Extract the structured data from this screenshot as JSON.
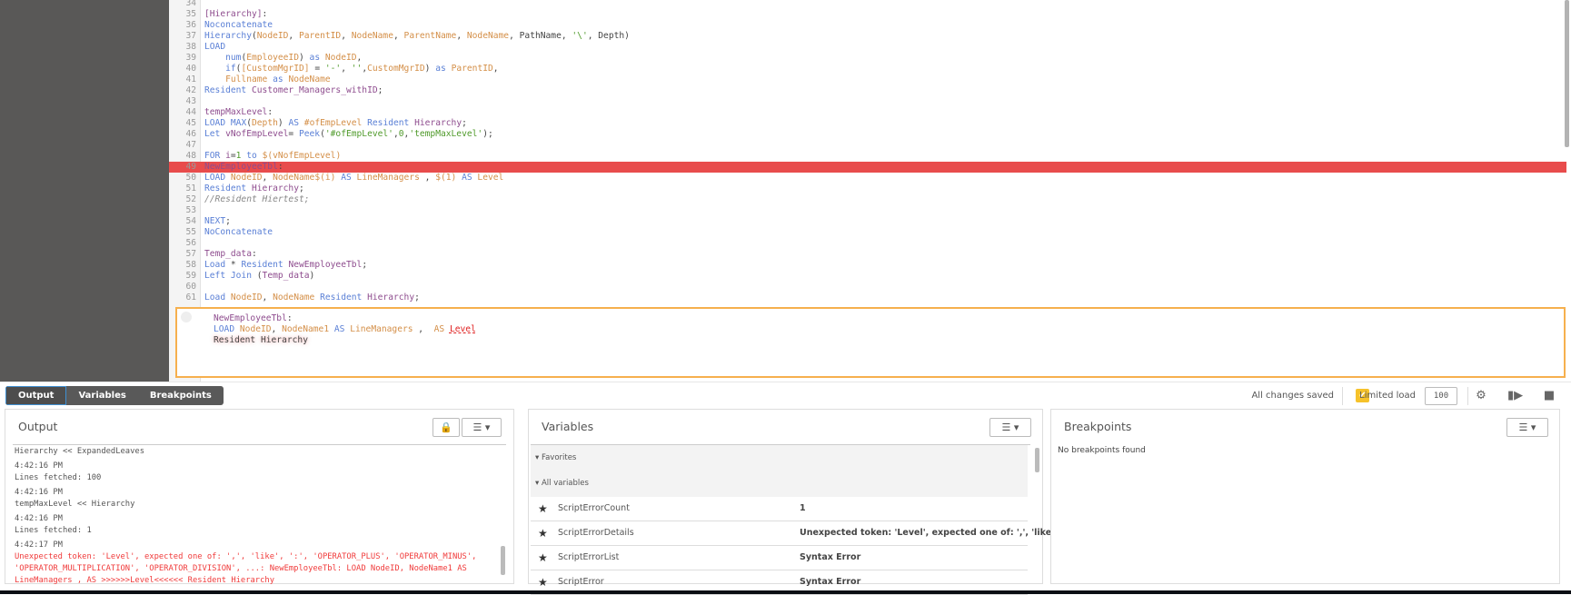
{
  "editor": {
    "lines": [
      {
        "n": "34",
        "t": []
      },
      {
        "n": "35",
        "t": [
          [
            "tbl",
            "[Hierarchy]"
          ],
          [
            "pl",
            ":"
          ]
        ]
      },
      {
        "n": "36",
        "t": [
          [
            "kw",
            "Noconcatenate"
          ]
        ]
      },
      {
        "n": "37",
        "t": [
          [
            "kw",
            "Hierarchy"
          ],
          [
            "pl",
            "("
          ],
          [
            "fld",
            "NodeID"
          ],
          [
            "pl",
            ", "
          ],
          [
            "fld",
            "ParentID"
          ],
          [
            "pl",
            ", "
          ],
          [
            "fld",
            "NodeName"
          ],
          [
            "pl",
            ", "
          ],
          [
            "fld",
            "ParentName"
          ],
          [
            "pl",
            ", "
          ],
          [
            "fld",
            "NodeName"
          ],
          [
            "pl",
            ", PathName, "
          ],
          [
            "str",
            "'\\'"
          ],
          [
            "pl",
            ", Depth)"
          ]
        ]
      },
      {
        "n": "38",
        "t": [
          [
            "kw",
            "LOAD"
          ]
        ]
      },
      {
        "n": "39",
        "t": [
          [
            "pl",
            "    "
          ],
          [
            "kw",
            "num"
          ],
          [
            "pl",
            "("
          ],
          [
            "fld",
            "EmployeeID"
          ],
          [
            "pl",
            ") "
          ],
          [
            "kw",
            "as"
          ],
          [
            "pl",
            " "
          ],
          [
            "fld",
            "NodeID"
          ],
          [
            "pl",
            ","
          ]
        ]
      },
      {
        "n": "40",
        "t": [
          [
            "pl",
            "    "
          ],
          [
            "kw",
            "if"
          ],
          [
            "pl",
            "("
          ],
          [
            "fld",
            "[CustomMgrID]"
          ],
          [
            "pl",
            " = "
          ],
          [
            "str",
            "'-'"
          ],
          [
            "pl",
            ", "
          ],
          [
            "str",
            "''"
          ],
          [
            "pl",
            ","
          ],
          [
            "fld",
            "CustomMgrID"
          ],
          [
            "pl",
            ") "
          ],
          [
            "kw",
            "as"
          ],
          [
            "pl",
            " "
          ],
          [
            "fld",
            "ParentID"
          ],
          [
            "pl",
            ","
          ]
        ]
      },
      {
        "n": "41",
        "t": [
          [
            "pl",
            "    "
          ],
          [
            "fld",
            "Fullname"
          ],
          [
            "pl",
            " "
          ],
          [
            "kw",
            "as"
          ],
          [
            "pl",
            " "
          ],
          [
            "fld",
            "NodeName"
          ]
        ]
      },
      {
        "n": "42",
        "t": [
          [
            "kw",
            "Resident"
          ],
          [
            "pl",
            " "
          ],
          [
            "tbl",
            "Customer_Managers_withID"
          ],
          [
            "pl",
            ";"
          ]
        ]
      },
      {
        "n": "43",
        "t": []
      },
      {
        "n": "44",
        "t": [
          [
            "tbl",
            "tempMaxLevel"
          ],
          [
            "pl",
            ":"
          ]
        ]
      },
      {
        "n": "45",
        "t": [
          [
            "kw",
            "LOAD"
          ],
          [
            "pl",
            " "
          ],
          [
            "kw",
            "MAX"
          ],
          [
            "pl",
            "("
          ],
          [
            "fld",
            "Depth"
          ],
          [
            "pl",
            ") "
          ],
          [
            "kw",
            "AS"
          ],
          [
            "pl",
            " "
          ],
          [
            "fld",
            "#ofEmpLevel"
          ],
          [
            "pl",
            " "
          ],
          [
            "kw",
            "Resident"
          ],
          [
            "pl",
            " "
          ],
          [
            "tbl",
            "Hierarchy"
          ],
          [
            "pl",
            ";"
          ]
        ]
      },
      {
        "n": "46",
        "t": [
          [
            "kw",
            "Let"
          ],
          [
            "pl",
            " "
          ],
          [
            "tbl",
            "vNofEmpLevel"
          ],
          [
            "pl",
            "= "
          ],
          [
            "kw",
            "Peek"
          ],
          [
            "pl",
            "("
          ],
          [
            "str",
            "'#ofEmpLevel'"
          ],
          [
            "pl",
            ","
          ],
          [
            "num",
            "0"
          ],
          [
            "pl",
            ","
          ],
          [
            "str",
            "'tempMaxLevel'"
          ],
          [
            "pl",
            ");"
          ]
        ]
      },
      {
        "n": "47",
        "t": []
      },
      {
        "n": "48",
        "t": [
          [
            "kw",
            "FOR"
          ],
          [
            "pl",
            " "
          ],
          [
            "tbl",
            "i"
          ],
          [
            "pl",
            "="
          ],
          [
            "num",
            "1"
          ],
          [
            "pl",
            " "
          ],
          [
            "kw",
            "to"
          ],
          [
            "pl",
            " "
          ],
          [
            "fld",
            "$(vNofEmpLevel)"
          ]
        ]
      },
      {
        "n": "49",
        "t": [
          [
            "tbl",
            "NewEmployeeTbl"
          ],
          [
            "pl",
            ":"
          ]
        ],
        "highlight": true
      },
      {
        "n": "50",
        "t": [
          [
            "kw",
            "LOAD"
          ],
          [
            "pl",
            " "
          ],
          [
            "fld",
            "NodeID"
          ],
          [
            "pl",
            ", "
          ],
          [
            "fld",
            "NodeName$(i)"
          ],
          [
            "pl",
            " "
          ],
          [
            "kw",
            "AS"
          ],
          [
            "pl",
            " "
          ],
          [
            "fld",
            "LineManagers"
          ],
          [
            "pl",
            " , "
          ],
          [
            "fld",
            "$(1)"
          ],
          [
            "pl",
            " "
          ],
          [
            "kw",
            "AS"
          ],
          [
            "pl",
            " "
          ],
          [
            "fld",
            "Level"
          ]
        ]
      },
      {
        "n": "51",
        "t": [
          [
            "kw",
            "Resident"
          ],
          [
            "pl",
            " "
          ],
          [
            "tbl",
            "Hierarchy"
          ],
          [
            "pl",
            ";"
          ]
        ]
      },
      {
        "n": "52",
        "t": [
          [
            "cmt",
            "//Resident Hiertest;"
          ]
        ]
      },
      {
        "n": "53",
        "t": []
      },
      {
        "n": "54",
        "t": [
          [
            "kw",
            "NEXT"
          ],
          [
            "pl",
            ";"
          ]
        ]
      },
      {
        "n": "55",
        "t": [
          [
            "kw",
            "NoConcatenate"
          ]
        ]
      },
      {
        "n": "56",
        "t": []
      },
      {
        "n": "57",
        "t": [
          [
            "tbl",
            "Temp_data"
          ],
          [
            "pl",
            ":"
          ]
        ]
      },
      {
        "n": "58",
        "t": [
          [
            "kw",
            "Load"
          ],
          [
            "pl",
            " * "
          ],
          [
            "kw",
            "Resident"
          ],
          [
            "pl",
            " "
          ],
          [
            "tbl",
            "NewEmployeeTbl"
          ],
          [
            "pl",
            ";"
          ]
        ]
      },
      {
        "n": "59",
        "t": [
          [
            "kw",
            "Left Join"
          ],
          [
            "pl",
            " ("
          ],
          [
            "tbl",
            "Temp_data"
          ],
          [
            "pl",
            ")"
          ]
        ]
      },
      {
        "n": "60",
        "t": []
      },
      {
        "n": "61",
        "t": [
          [
            "kw",
            "Load"
          ],
          [
            "pl",
            " "
          ],
          [
            "fld",
            "NodeID"
          ],
          [
            "pl",
            ", "
          ],
          [
            "fld",
            "NodeName"
          ],
          [
            "pl",
            " "
          ],
          [
            "kw",
            "Resident"
          ],
          [
            "pl",
            " "
          ],
          [
            "tbl",
            "Hierarchy"
          ],
          [
            "pl",
            ";"
          ]
        ]
      }
    ],
    "popup_lines": [
      [
        [
          "tbl",
          "NewEmployeeTbl"
        ],
        [
          "pl",
          ":"
        ]
      ],
      [
        [
          "kw",
          "LOAD"
        ],
        [
          "pl",
          " "
        ],
        [
          "fld",
          "NodeID"
        ],
        [
          "pl",
          ", "
        ],
        [
          "fld",
          "NodeName1"
        ],
        [
          "pl",
          " "
        ],
        [
          "kw",
          "AS"
        ],
        [
          "pl",
          " "
        ],
        [
          "fld",
          "LineManagers"
        ],
        [
          "pl",
          " ,  "
        ],
        [
          "fld",
          "AS"
        ],
        [
          "pl",
          " "
        ],
        [
          "err",
          "Level"
        ]
      ],
      [
        [
          "glow",
          "Resident Hierarchy"
        ]
      ]
    ]
  },
  "tabs": [
    "Output",
    "Variables",
    "Breakpoints"
  ],
  "toolbar": {
    "status": "All changes saved",
    "limited_load_label": "Limited load",
    "limited_load_checked": true,
    "limited_load_value": "100",
    "check_glyph": "✔",
    "accent": "#f6c22a"
  },
  "output": {
    "title": "Output",
    "log": [
      {
        "type": "msg",
        "text": "Hierarchy << ExpandedLeaves"
      },
      {
        "type": "ts",
        "text": "4:42:16 PM"
      },
      {
        "type": "msg",
        "text": "Lines fetched: 100"
      },
      {
        "type": "ts",
        "text": "4:42:16 PM"
      },
      {
        "type": "msg",
        "text": "tempMaxLevel << Hierarchy"
      },
      {
        "type": "ts",
        "text": "4:42:16 PM"
      },
      {
        "type": "msg",
        "text": "Lines fetched: 1"
      },
      {
        "type": "ts",
        "text": "4:42:17 PM"
      },
      {
        "type": "error",
        "text": "Unexpected token: 'Level', expected one of: ',', 'like', ':', 'OPERATOR_PLUS', 'OPERATOR_MINUS', 'OPERATOR_MULTIPLICATION', 'OPERATOR_DIVISION', ...: NewEmployeeTbl: LOAD NodeID, NodeName1 AS LineManagers , AS >>>>>>Level<<<<<< Resident Hierarchy"
      }
    ]
  },
  "variables": {
    "title": "Variables",
    "groups": [
      "Favorites",
      "All variables"
    ],
    "rows": [
      {
        "name": "ScriptErrorCount",
        "value": "1"
      },
      {
        "name": "ScriptErrorDetails",
        "value": "Unexpected token: 'Level', expected one of: ',', 'like', ':', '..."
      },
      {
        "name": "ScriptErrorList",
        "value": "Syntax Error"
      },
      {
        "name": "ScriptError",
        "value": "Syntax Error"
      }
    ]
  },
  "breakpoints": {
    "title": "Breakpoints",
    "empty": "No breakpoints found"
  }
}
